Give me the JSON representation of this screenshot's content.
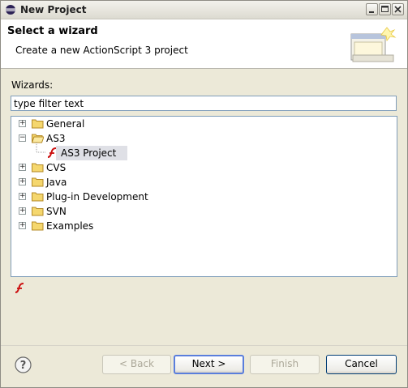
{
  "window": {
    "title": "New Project",
    "icon": "eclipse-icon",
    "controls": [
      "minimize-icon",
      "maximize-icon",
      "close-icon"
    ]
  },
  "banner": {
    "title": "Select a wizard",
    "description": "Create a new ActionScript 3 project",
    "art": "wizard-banner-icon"
  },
  "wizards": {
    "label": "Wizards:",
    "filter_value": "type filter text",
    "tree": [
      {
        "label": "General",
        "expanded": false,
        "icon": "folder-icon"
      },
      {
        "label": "AS3",
        "expanded": true,
        "icon": "folder-open-icon"
      },
      {
        "label": "AS3 Project",
        "child": true,
        "selected": true,
        "icon": "flash-icon"
      },
      {
        "label": "CVS",
        "expanded": false,
        "icon": "folder-icon"
      },
      {
        "label": "Java",
        "expanded": false,
        "icon": "folder-icon"
      },
      {
        "label": "Plug-in Development",
        "expanded": false,
        "icon": "folder-icon"
      },
      {
        "label": "SVN",
        "expanded": false,
        "icon": "folder-icon"
      },
      {
        "label": "Examples",
        "expanded": false,
        "icon": "folder-icon"
      }
    ]
  },
  "status_icon": "flash-icon",
  "buttons": {
    "back": "< Back",
    "next": "Next >",
    "finish": "Finish",
    "cancel": "Cancel"
  },
  "colors": {
    "dialog_bg": "#ece9d8",
    "selection": "#dfe0e6",
    "flash_red": "#cc1111",
    "folder_yellow": "#f5d76e"
  }
}
